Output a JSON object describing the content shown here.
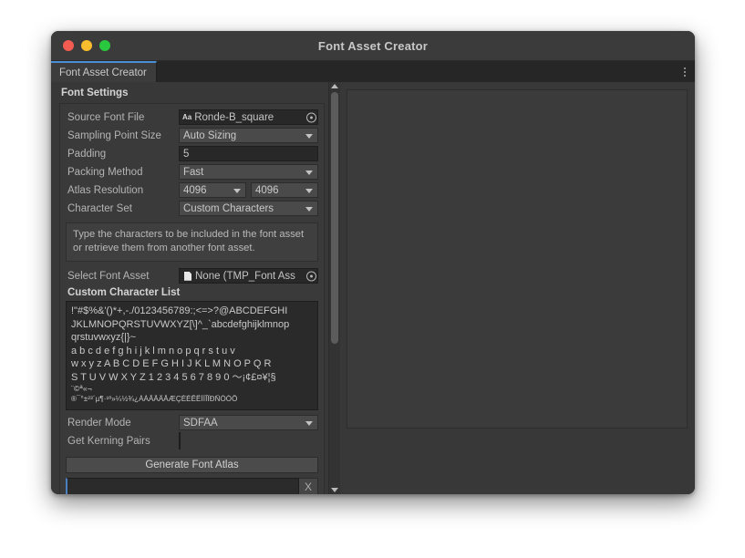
{
  "window": {
    "title": "Font Asset Creator",
    "traffic_lights": [
      "close-button",
      "minimize-button",
      "zoom-button"
    ],
    "colors": {
      "close": "#f45b51",
      "minimize": "#f9bd2e",
      "zoom": "#29c83f",
      "tab_accent": "#4a8fd6",
      "panel_bg": "#383838"
    }
  },
  "tabbar": {
    "tab_label": "Font Asset Creator",
    "menu_icon": "kebab-menu-icon"
  },
  "settings": {
    "section_title": "Font Settings",
    "rows": [
      {
        "label": "Source Font File",
        "value": "Ronde-B_square",
        "type": "object-field",
        "icon": "aa-font-icon"
      },
      {
        "label": "Sampling Point Size",
        "value": "Auto Sizing",
        "type": "dropdown"
      },
      {
        "label": "Padding",
        "value": "5",
        "type": "text-field"
      },
      {
        "label": "Packing Method",
        "value": "Fast",
        "type": "dropdown"
      },
      {
        "label": "Atlas Resolution",
        "value": "4096",
        "value2": "4096",
        "type": "dual-dropdown"
      },
      {
        "label": "Character Set",
        "value": "Custom Characters",
        "type": "dropdown"
      }
    ],
    "help_text": "Type the characters to be included in the font asset or retrieve them from another font asset.",
    "select_font_asset": {
      "label": "Select Font Asset",
      "value": "None (TMP_Font Ass",
      "icon": "document-icon"
    },
    "custom_character_list": {
      "title": "Custom Character List",
      "lines": [
        "!\"#$%&'()*+,-./0123456789:;<=>?@ABCDEFGHI",
        "JKLMNOPQRSTUVWXYZ[\\]^_`abcdefghijklmnop",
        "qrstuvwxyz{|}~",
        "a b c d e f g h i j k l m n o p q r s t u v",
        "w x y z A B C D E F G H I J K L M N O P Q R",
        "S T U V W X Y Z 1 2 3 4 5 6 7 8 9 0 ～¡¢£¤¥¦§",
        "¨©ª«¬",
        "®¯°±²³´µ¶·¹º»¼½¾¿ÀÁÂÃÄÅÆÇÈÉÊËÌÍÎÏÐÑÒÓÔ"
      ]
    },
    "render_mode": {
      "label": "Render Mode",
      "value": "SDFAA"
    },
    "get_kerning_pairs": {
      "label": "Get Kerning Pairs",
      "checked": false
    },
    "generate_button": "Generate Font Atlas",
    "progress_field_value": "",
    "clear_button": "X"
  },
  "scrollbar": {
    "up_arrow": "scroll-up-arrow-icon",
    "down_arrow": "scroll-down-arrow-icon"
  },
  "preview": {
    "content": ""
  }
}
